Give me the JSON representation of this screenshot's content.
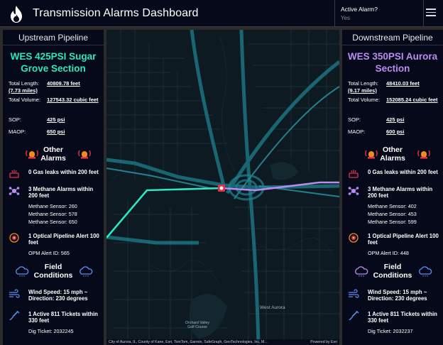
{
  "header": {
    "title": "Transmission Alarms Dashboard",
    "active_alarm_label": "Active Alarm?",
    "active_alarm_value": "Yes",
    "logo_icon": "flame-icon",
    "menu_icon": "hamburger-menu-icon"
  },
  "upstream": {
    "panel_title": "Upstream Pipeline",
    "section_name": "WES 425PSI Sugar Grove Section",
    "total_length_label": "Total Length:",
    "total_length_value": "40809.78 feet",
    "total_length_miles": "(7.73 miles)",
    "total_volume_label": "Total Volume:",
    "total_volume_value": "127543.32 cubic feet",
    "sop_label": "SOP:",
    "sop_value": "425 psi",
    "maop_label": "MAOP:",
    "maop_value": "650 psi",
    "other_alarms_title": "Other Alarms",
    "gas_leaks": "0 Gas leaks within 200 feet",
    "methane_alarms": "3 Methane Alarms within 200 feet",
    "methane_sensors": [
      "Methane Sensor: 260",
      "Methane Sensor: 578",
      "Methane Sensor: 650"
    ],
    "optical_alert": "1 Optical Pipeline Alert 100 feet",
    "opm_alert": "OPM Alert ID: 565",
    "field_conditions_title": "Field Conditions",
    "wind": "Wind Speed: 15 mph ~ Direction: 230 degrees",
    "tickets": "1 Active 811 Tickets within 330 feet",
    "dig_ticket": "Dig Ticket: 2032245"
  },
  "downstream": {
    "panel_title": "Downstream Pipeline",
    "section_name": "WES 350PSI Aurora Section",
    "total_length_label": "Total Length:",
    "total_length_value": "48410.03 feet",
    "total_length_miles": "(9.17 miles)",
    "total_volume_label": "Total Volume:",
    "total_volume_value": "152085.24 cubic feet",
    "sop_label": "SOP:",
    "sop_value": "425 psi",
    "maop_label": "MAOP:",
    "maop_value": "600 psi",
    "other_alarms_title": "Other Alarms",
    "gas_leaks": "0 Gas leaks within 200 feet",
    "methane_alarms": "3 Methane Alarms within 200 feet",
    "methane_sensors": [
      "Methane Sensor: 402",
      "Methane Sensor: 453",
      "Methane Sensor: 599"
    ],
    "optical_alert": "1 Optical Pipeline Alert 100 feet",
    "opm_alert": "OPM Alert ID: 448",
    "field_conditions_title": "Field Conditions",
    "wind": "Wind Speed: 15 mph ~ Direction: 230 degrees",
    "tickets": "1 Active 811 Tickets within 330 feet",
    "dig_ticket": "Dig Ticket: 2032237"
  },
  "map": {
    "labels": {
      "west_aurora": "West Aurora",
      "golf": "Orchard Valley Golf Course"
    },
    "attribution": "City of Aurora, IL, County of Kane, Esri, TomTom, Garmin, SafeGraph, GeoTechnologies, Inc, M...",
    "powered_by": "Powered by Esri",
    "colors": {
      "upstream_line": "#2ee6c0",
      "downstream_line": "#b98cf2",
      "valve_marker": "#e0334a"
    }
  },
  "icons": {
    "siren": "siren-icon",
    "gas_leak": "gas-leak-icon",
    "methane": "methane-sensor-icon",
    "optical": "optical-alert-icon",
    "cloud": "cloud-icon",
    "wind": "wind-icon",
    "shovel": "shovel-icon"
  }
}
